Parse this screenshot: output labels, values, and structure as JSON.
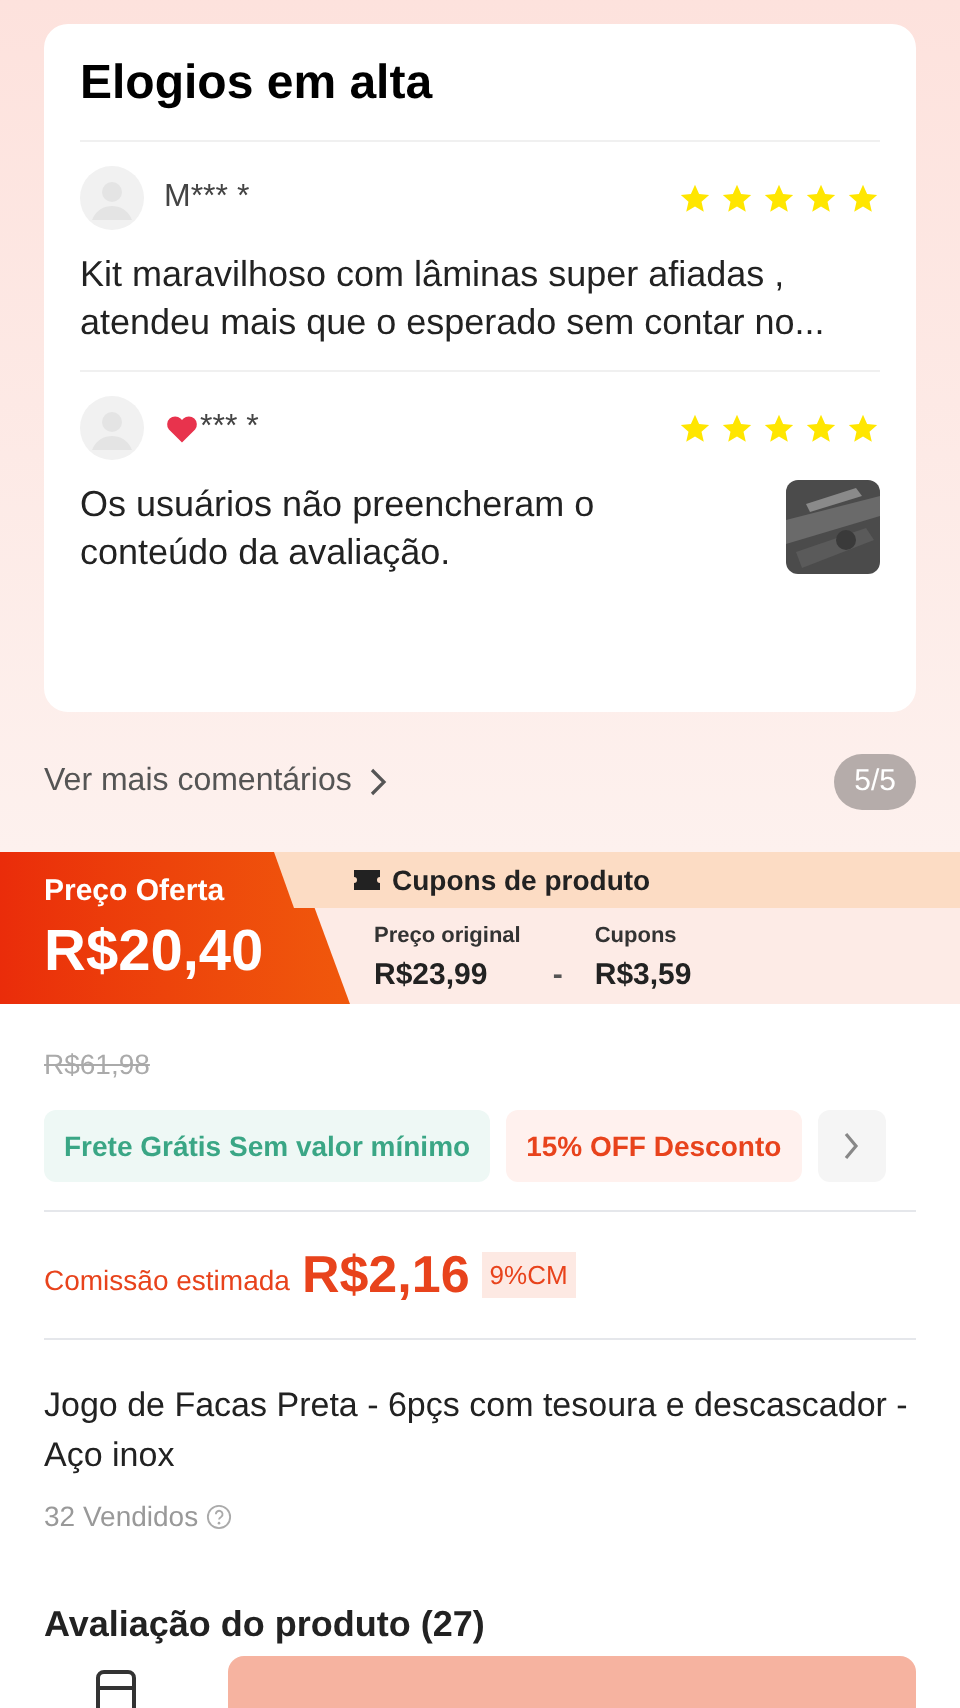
{
  "reviews_card": {
    "title": "Elogios em alta",
    "reviews": [
      {
        "user": "M*** *",
        "heart": false,
        "stars": 5,
        "text": "Kit maravilhoso com lâminas super afiadas , atendeu mais que o esperado sem contar no...",
        "has_photo": false
      },
      {
        "user": "*** *",
        "heart": true,
        "stars": 5,
        "text": "Os usuários não preencheram o conteúdo da avaliação.",
        "has_photo": true
      }
    ]
  },
  "more_comments": {
    "label": "Ver mais comentários",
    "counter": "5/5"
  },
  "offer": {
    "label": "Preço Oferta",
    "price": "R$20,40",
    "coupons_title": "Cupons de produto",
    "original_label": "Preço original",
    "original_price": "R$23,99",
    "minus": "-",
    "coupon_label": "Cupons",
    "coupon_value": "R$3,59"
  },
  "old_price": "R$61,98",
  "chips": [
    {
      "kind": "shipping",
      "label": "Frete Grátis Sem valor mínimo"
    },
    {
      "kind": "discount",
      "label": "15% OFF Desconto"
    }
  ],
  "commission": {
    "label": "Comissão estimada",
    "value": "R$2,16",
    "rate": "9%CM"
  },
  "product": {
    "title": "Jogo de Facas Preta - 6pçs com tesoura e descascador - Aço inox",
    "sold": "32 Vendidos"
  },
  "section_heading": "Avaliação do produto (27)"
}
